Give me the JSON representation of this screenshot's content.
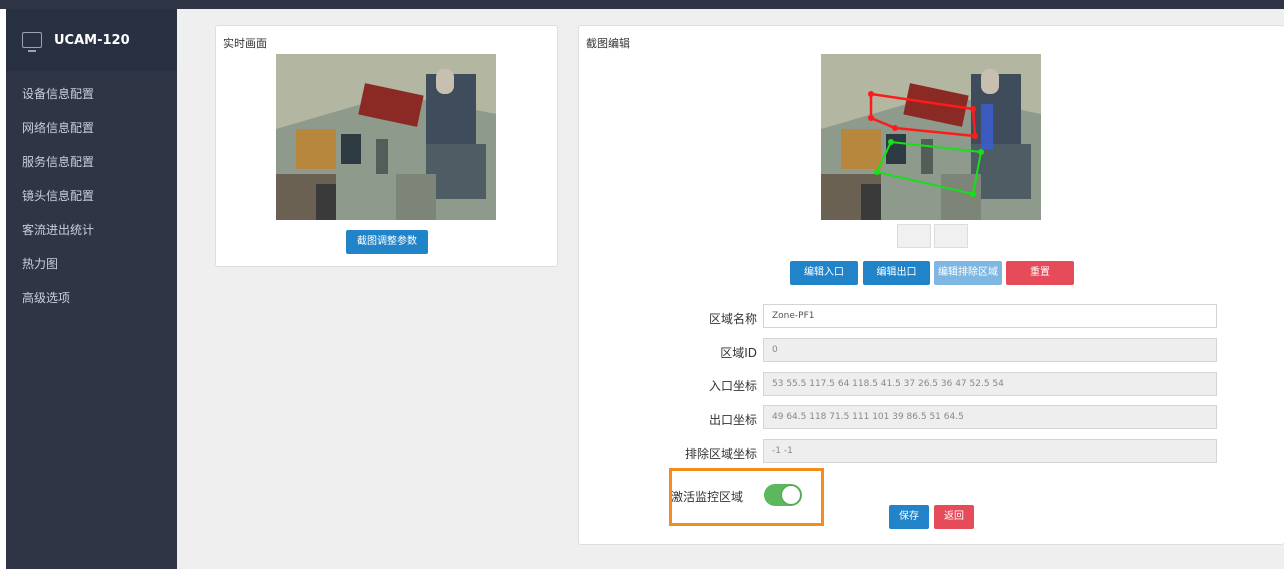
{
  "app": {
    "title": "UCAM-120"
  },
  "sidebar": {
    "items": [
      {
        "label": "设备信息配置"
      },
      {
        "label": "网络信息配置"
      },
      {
        "label": "服务信息配置"
      },
      {
        "label": "镜头信息配置"
      },
      {
        "label": "客流进出统计"
      },
      {
        "label": "热力图"
      },
      {
        "label": "高级选项"
      }
    ]
  },
  "live_panel": {
    "title": "实时画面",
    "adjust_button": "截图调整参数"
  },
  "edit_panel": {
    "title": "截图编辑",
    "buttons": {
      "edit_entry": "编辑入口",
      "edit_exit": "编辑出口",
      "edit_exclude": "编辑排除区域",
      "reset": "重置",
      "save": "保存",
      "back": "返回"
    },
    "form": {
      "zone_name": {
        "label": "区域名称",
        "value": "Zone-PF1"
      },
      "zone_id": {
        "label": "区域ID",
        "value": "0"
      },
      "entry_coords": {
        "label": "入口坐标",
        "value": "53 55.5 117.5 64 118.5 41.5 37 26.5 36 47 52.5 54"
      },
      "exit_coords": {
        "label": "出口坐标",
        "value": "49 64.5 118 71.5 111 101 39 86.5 51 64.5"
      },
      "exclude_coords": {
        "label": "排除区域坐标",
        "value": "-1 -1"
      },
      "activate": {
        "label": "激活监控区域",
        "on": true
      }
    }
  },
  "colors": {
    "sidebar_bg": "#2f3545",
    "primary": "#2284c8",
    "danger": "#e64b59",
    "toggle_on": "#5cb85c",
    "highlight": "#f28c1c",
    "entry_zone": "#ff0000",
    "exit_zone": "#00dd00"
  }
}
